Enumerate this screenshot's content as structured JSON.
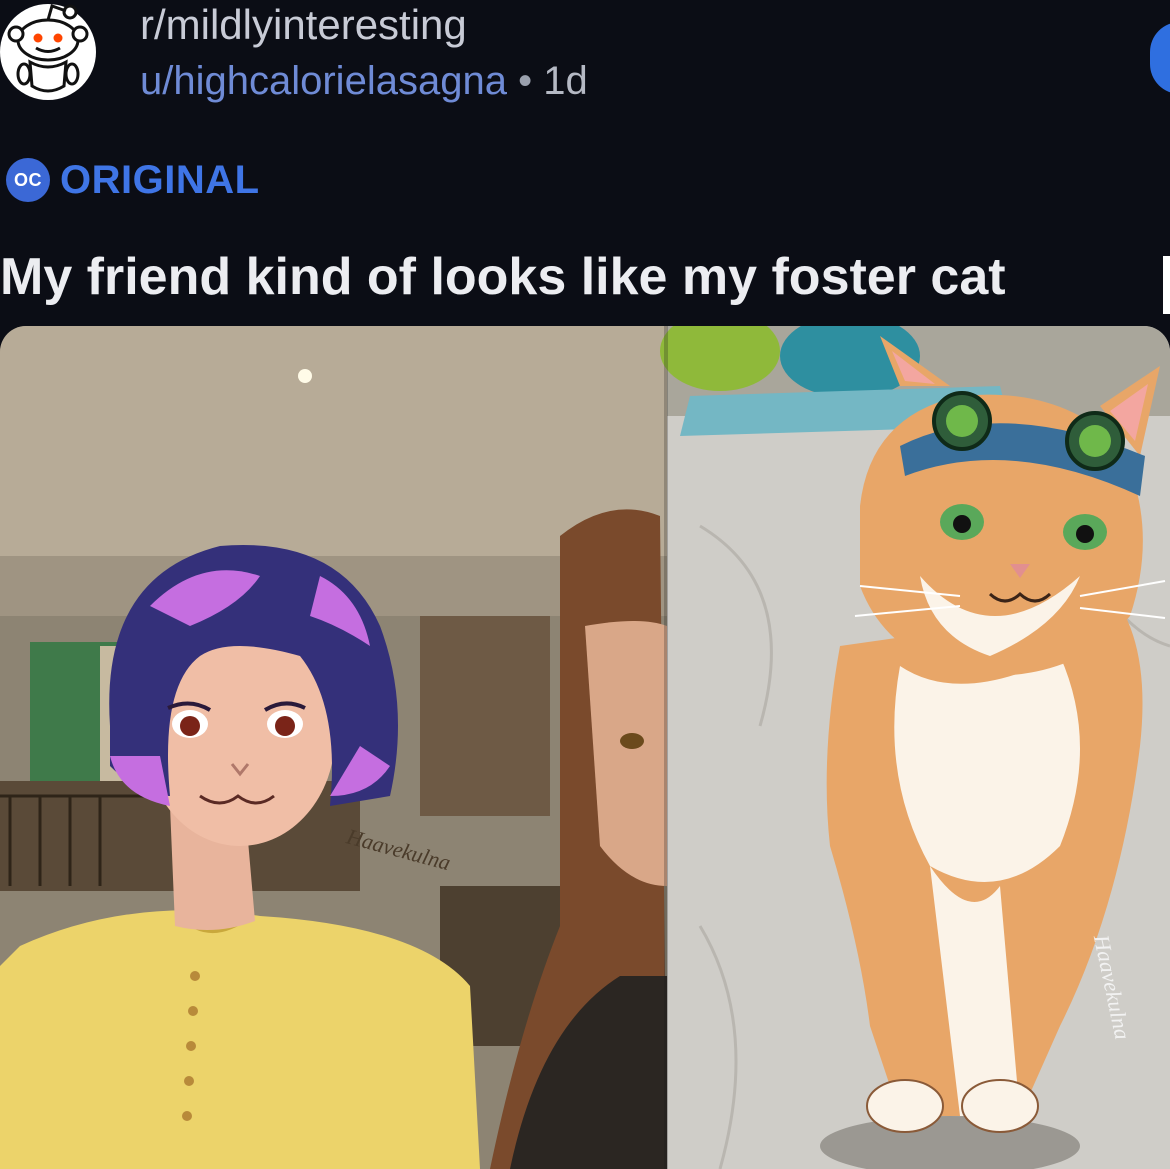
{
  "post": {
    "subreddit": "r/mildlyinteresting",
    "username": "u/highcalorielasagna",
    "separator": "•",
    "age": "1d",
    "flair_badge": "OC",
    "flair_label": "ORIGINAL",
    "title": "My friend kind of looks like my foster cat"
  },
  "icons": {
    "avatar": "reddit-snoo-icon",
    "flair": "oc-badge-icon"
  },
  "image": {
    "watermark_left": "Haavekulna",
    "watermark_right": "Haavekulna"
  },
  "colors": {
    "background": "#0b0d15",
    "username": "#6f8bd6",
    "flair": "#3f75e6",
    "title": "#ecedf1"
  }
}
